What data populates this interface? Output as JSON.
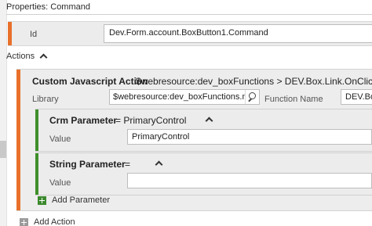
{
  "panel": {
    "title": "Properties: Command"
  },
  "id_field": {
    "label": "Id",
    "value": "Dev.Form.account.BoxButton1.Command"
  },
  "actions": {
    "label": "Actions",
    "action": {
      "type_label": "Custom Javascript Action",
      "target": "$webresource:dev_boxFunctions > DEV.Box.Link.OnClick",
      "library_label": "Library",
      "library_value": "$webresource:dev_boxFunctions.min.",
      "function_label": "Function Name",
      "function_value": "DEV.Bo",
      "parameters": [
        {
          "type": "Crm Parameter",
          "equals_value": "= PrimaryControl",
          "value_label": "Value",
          "value": "PrimaryControl"
        },
        {
          "type": "String Parameter",
          "equals_value": "=",
          "value_label": "Value",
          "value": ""
        }
      ],
      "add_parameter_label": "Add Parameter"
    },
    "add_action_label": "Add Action"
  },
  "colors": {
    "action_accent": "#e8702a",
    "parameter_accent": "#3f8f2b"
  },
  "icons": {
    "collapse": "chevron-up-icon",
    "search": "search-icon",
    "add": "plus-icon"
  }
}
